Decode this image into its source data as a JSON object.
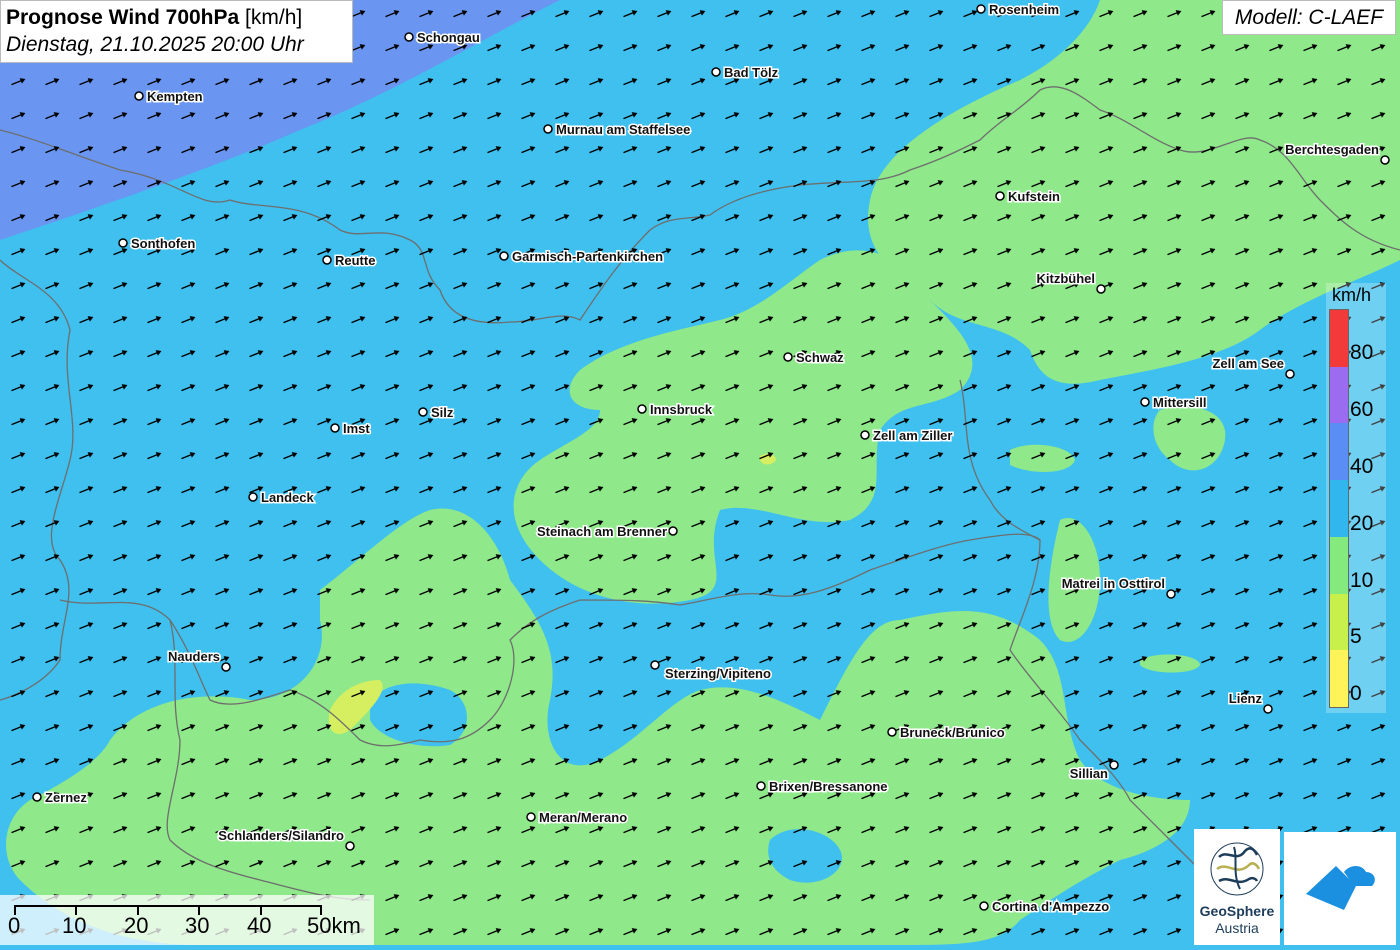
{
  "title": {
    "main": "Prognose Wind 700hPa",
    "unit": "[km/h]",
    "date": "Dienstag, 21.10.2025 20:00 Uhr"
  },
  "model": "Modell: C-LAEF",
  "legend": {
    "unit": "km/h",
    "labels": [
      "80",
      "60",
      "40",
      "20",
      "10",
      "5",
      "0"
    ],
    "colors": [
      "#f23a3a",
      "#9b6bf0",
      "#5b8ef5",
      "#31b7ee",
      "#84ea7e",
      "#c8f04a",
      "#fff35a"
    ]
  },
  "scalebar": {
    "labels": [
      "0",
      "10",
      "20",
      "30",
      "40",
      "50km"
    ]
  },
  "logos": {
    "geosphere_line1": "GeoSphere",
    "geosphere_line2": "Austria"
  },
  "map_colors": {
    "blue": "#3fc0ee",
    "green": "#8fe88a",
    "violet": "#6f91f2",
    "yellow": "#d6ef61"
  },
  "cities": [
    {
      "name": "Rosenheim"
    },
    {
      "name": "Schongau"
    },
    {
      "name": "Bad Tölz"
    },
    {
      "name": "Kempten"
    },
    {
      "name": "Murnau am Staffelsee"
    },
    {
      "name": "Berchtesgaden"
    },
    {
      "name": "Kufstein"
    },
    {
      "name": "Sonthofen"
    },
    {
      "name": "Reutte"
    },
    {
      "name": "Garmisch-Partenkirchen"
    },
    {
      "name": "Kitzbühel"
    },
    {
      "name": "Schwaz"
    },
    {
      "name": "Zell am See"
    },
    {
      "name": "Mittersill"
    },
    {
      "name": "Silz"
    },
    {
      "name": "Innsbruck"
    },
    {
      "name": "Imst"
    },
    {
      "name": "Zell am Ziller"
    },
    {
      "name": "Landeck"
    },
    {
      "name": "Steinach am Brenner"
    },
    {
      "name": "Matrei in Osttirol"
    },
    {
      "name": "Nauders"
    },
    {
      "name": "Sterzing/Vipiteno"
    },
    {
      "name": "Lienz"
    },
    {
      "name": "Bruneck/Brunico"
    },
    {
      "name": "Sillian"
    },
    {
      "name": "Brixen/Bressanone"
    },
    {
      "name": "Zernez"
    },
    {
      "name": "Meran/Merano"
    },
    {
      "name": "Schlanders/Silandro"
    },
    {
      "name": "Cortina d'Ampezzo"
    }
  ]
}
